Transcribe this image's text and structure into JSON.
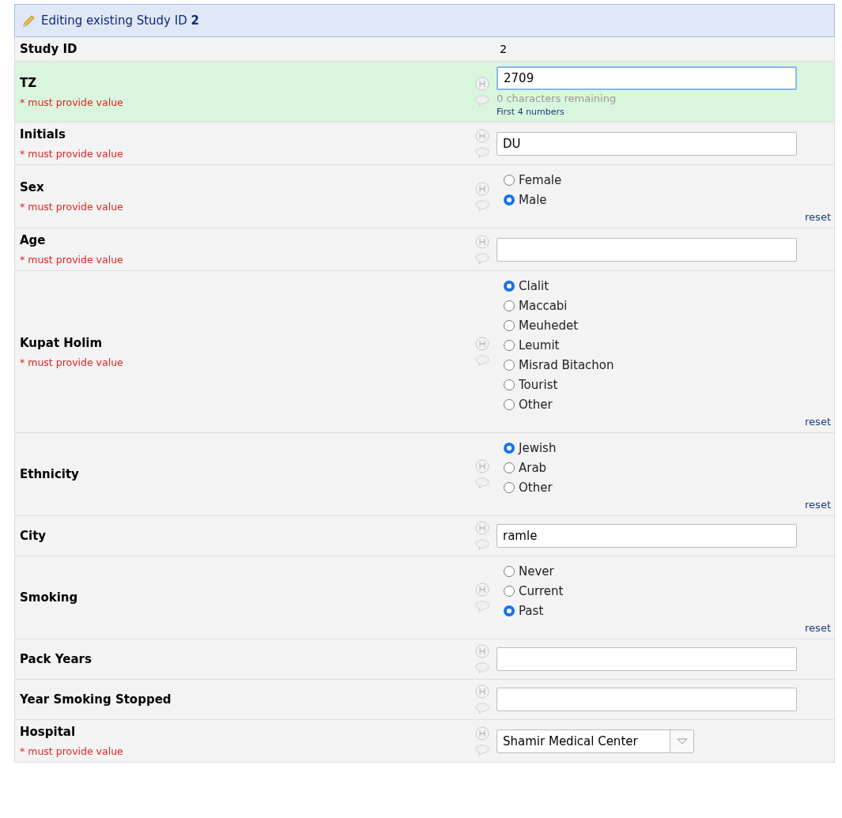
{
  "header": {
    "title": "Editing existing Study ID ",
    "record_id": "2"
  },
  "fields": [
    {
      "kind": "static",
      "label": "Study ID",
      "value": "2",
      "highlighted": false
    },
    {
      "kind": "text",
      "label": "TZ",
      "required_note": "* must provide value",
      "value": "2709",
      "focused": true,
      "highlighted": true,
      "counter": "0 characters remaining",
      "hint": "First 4 numbers"
    },
    {
      "kind": "text",
      "label": "Initials",
      "required_note": "* must provide value",
      "value": "DU",
      "focused": false,
      "highlighted": false
    },
    {
      "kind": "radio",
      "label": "Sex",
      "required_note": "* must provide value",
      "highlighted": false,
      "options": [
        {
          "label": "Female",
          "selected": false
        },
        {
          "label": "Male",
          "selected": true
        }
      ],
      "reset": "reset"
    },
    {
      "kind": "text",
      "label": "Age",
      "required_note": "* must provide value",
      "focused": false,
      "highlighted": false
    },
    {
      "kind": "radio",
      "label": "Kupat Holim",
      "required_note": "* must provide value",
      "highlighted": false,
      "options": [
        {
          "label": "Clalit",
          "selected": true
        },
        {
          "label": "Maccabi",
          "selected": false
        },
        {
          "label": "Meuhedet",
          "selected": false
        },
        {
          "label": "Leumit",
          "selected": false
        },
        {
          "label": "Misrad Bitachon",
          "selected": false
        },
        {
          "label": "Tourist",
          "selected": false
        },
        {
          "label": "Other",
          "selected": false
        }
      ],
      "reset": "reset"
    },
    {
      "kind": "radio",
      "label": "Ethnicity",
      "highlighted": false,
      "options": [
        {
          "label": "Jewish",
          "selected": true
        },
        {
          "label": "Arab",
          "selected": false
        },
        {
          "label": "Other",
          "selected": false
        }
      ],
      "reset": "reset"
    },
    {
      "kind": "text",
      "label": "City",
      "value": "ramle",
      "focused": false,
      "highlighted": false
    },
    {
      "kind": "radio",
      "label": "Smoking",
      "highlighted": false,
      "options": [
        {
          "label": "Never",
          "selected": false
        },
        {
          "label": "Current",
          "selected": false
        },
        {
          "label": "Past",
          "selected": true
        }
      ],
      "reset": "reset"
    },
    {
      "kind": "text",
      "label": "Pack Years",
      "focused": false,
      "highlighted": false
    },
    {
      "kind": "text",
      "label": "Year Smoking Stopped",
      "focused": false,
      "highlighted": false
    },
    {
      "kind": "select",
      "label": "Hospital",
      "required_note": "* must provide value",
      "value": "Shamir Medical Center",
      "highlighted": false
    }
  ]
}
